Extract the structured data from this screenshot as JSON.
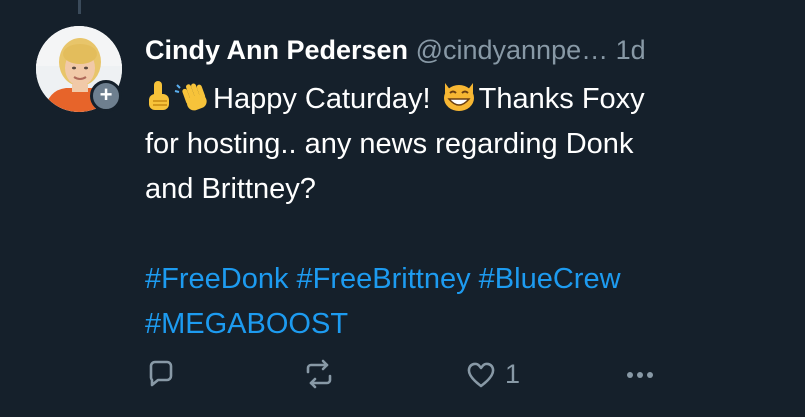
{
  "tweet": {
    "author": {
      "display_name": "Cindy Ann Pedersen",
      "handle": "@cindyannpe…",
      "follow_badge": "+"
    },
    "timestamp": "1d",
    "text": {
      "line1_a": "Happy Caturday! ",
      "line1_b": "Thanks Foxy",
      "line2": "for hosting.. any news regarding Donk",
      "line3": "and Brittney?"
    },
    "emojis": [
      "point-up-emoji",
      "waving-hand-emoji",
      "grinning-cat-emoji"
    ],
    "hashtags": [
      "#FreeDonk",
      "#FreeBrittney",
      "#BlueCrew",
      "#MEGABOOST"
    ],
    "actions": {
      "reply_icon": "reply-icon",
      "retweet_icon": "retweet-icon",
      "like_icon": "heart-icon",
      "like_count": "1",
      "more_icon": "more-icon"
    }
  },
  "colors": {
    "background": "#15202b",
    "text": "#ffffff",
    "muted": "#8899a6",
    "link": "#1d9bf0"
  }
}
